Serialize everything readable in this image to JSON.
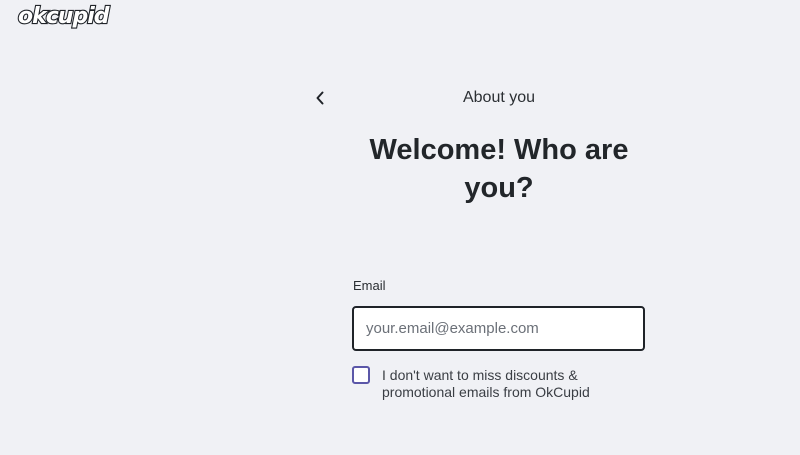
{
  "brand": {
    "logo_text": "okcupid"
  },
  "header": {
    "back_icon": "chevron-left-icon",
    "step_title": "About you"
  },
  "main": {
    "headline": "Welcome! Who are you?",
    "email": {
      "label": "Email",
      "placeholder": "your.email@example.com",
      "value": ""
    },
    "consent": {
      "checked": false,
      "text": "I don't want to miss discounts & promotional emails from OkCupid"
    }
  },
  "colors": {
    "background": "#f0f1f5",
    "text": "#1f2328",
    "checkbox_border": "#5b57a8",
    "input_border": "#1f2328"
  }
}
